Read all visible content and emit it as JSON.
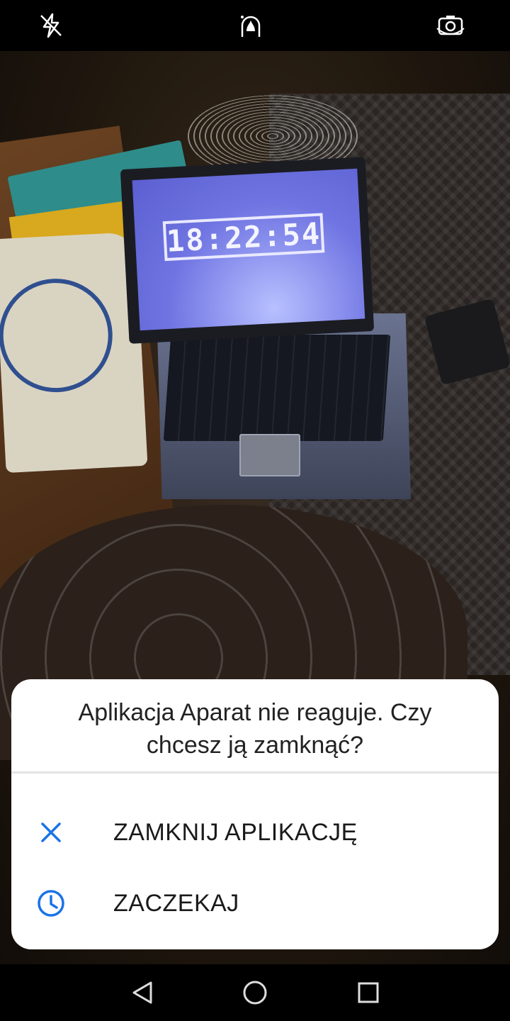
{
  "camera": {
    "top_icons": [
      "flash-off-icon",
      "beauty-mode-icon",
      "switch-camera-icon"
    ],
    "scene_clock": "18:22:54"
  },
  "dialog": {
    "title": "Aplikacja Aparat nie reaguje. Czy chcesz ją zamknąć?",
    "options": [
      {
        "label": "ZAMKNIJ APLIKACJĘ",
        "icon": "close-icon"
      },
      {
        "label": "ZACZEKAJ",
        "icon": "clock-icon"
      }
    ],
    "accent_color": "#1a73e8"
  },
  "navbar": {
    "icons": [
      "back-icon",
      "home-icon",
      "recents-icon"
    ]
  }
}
